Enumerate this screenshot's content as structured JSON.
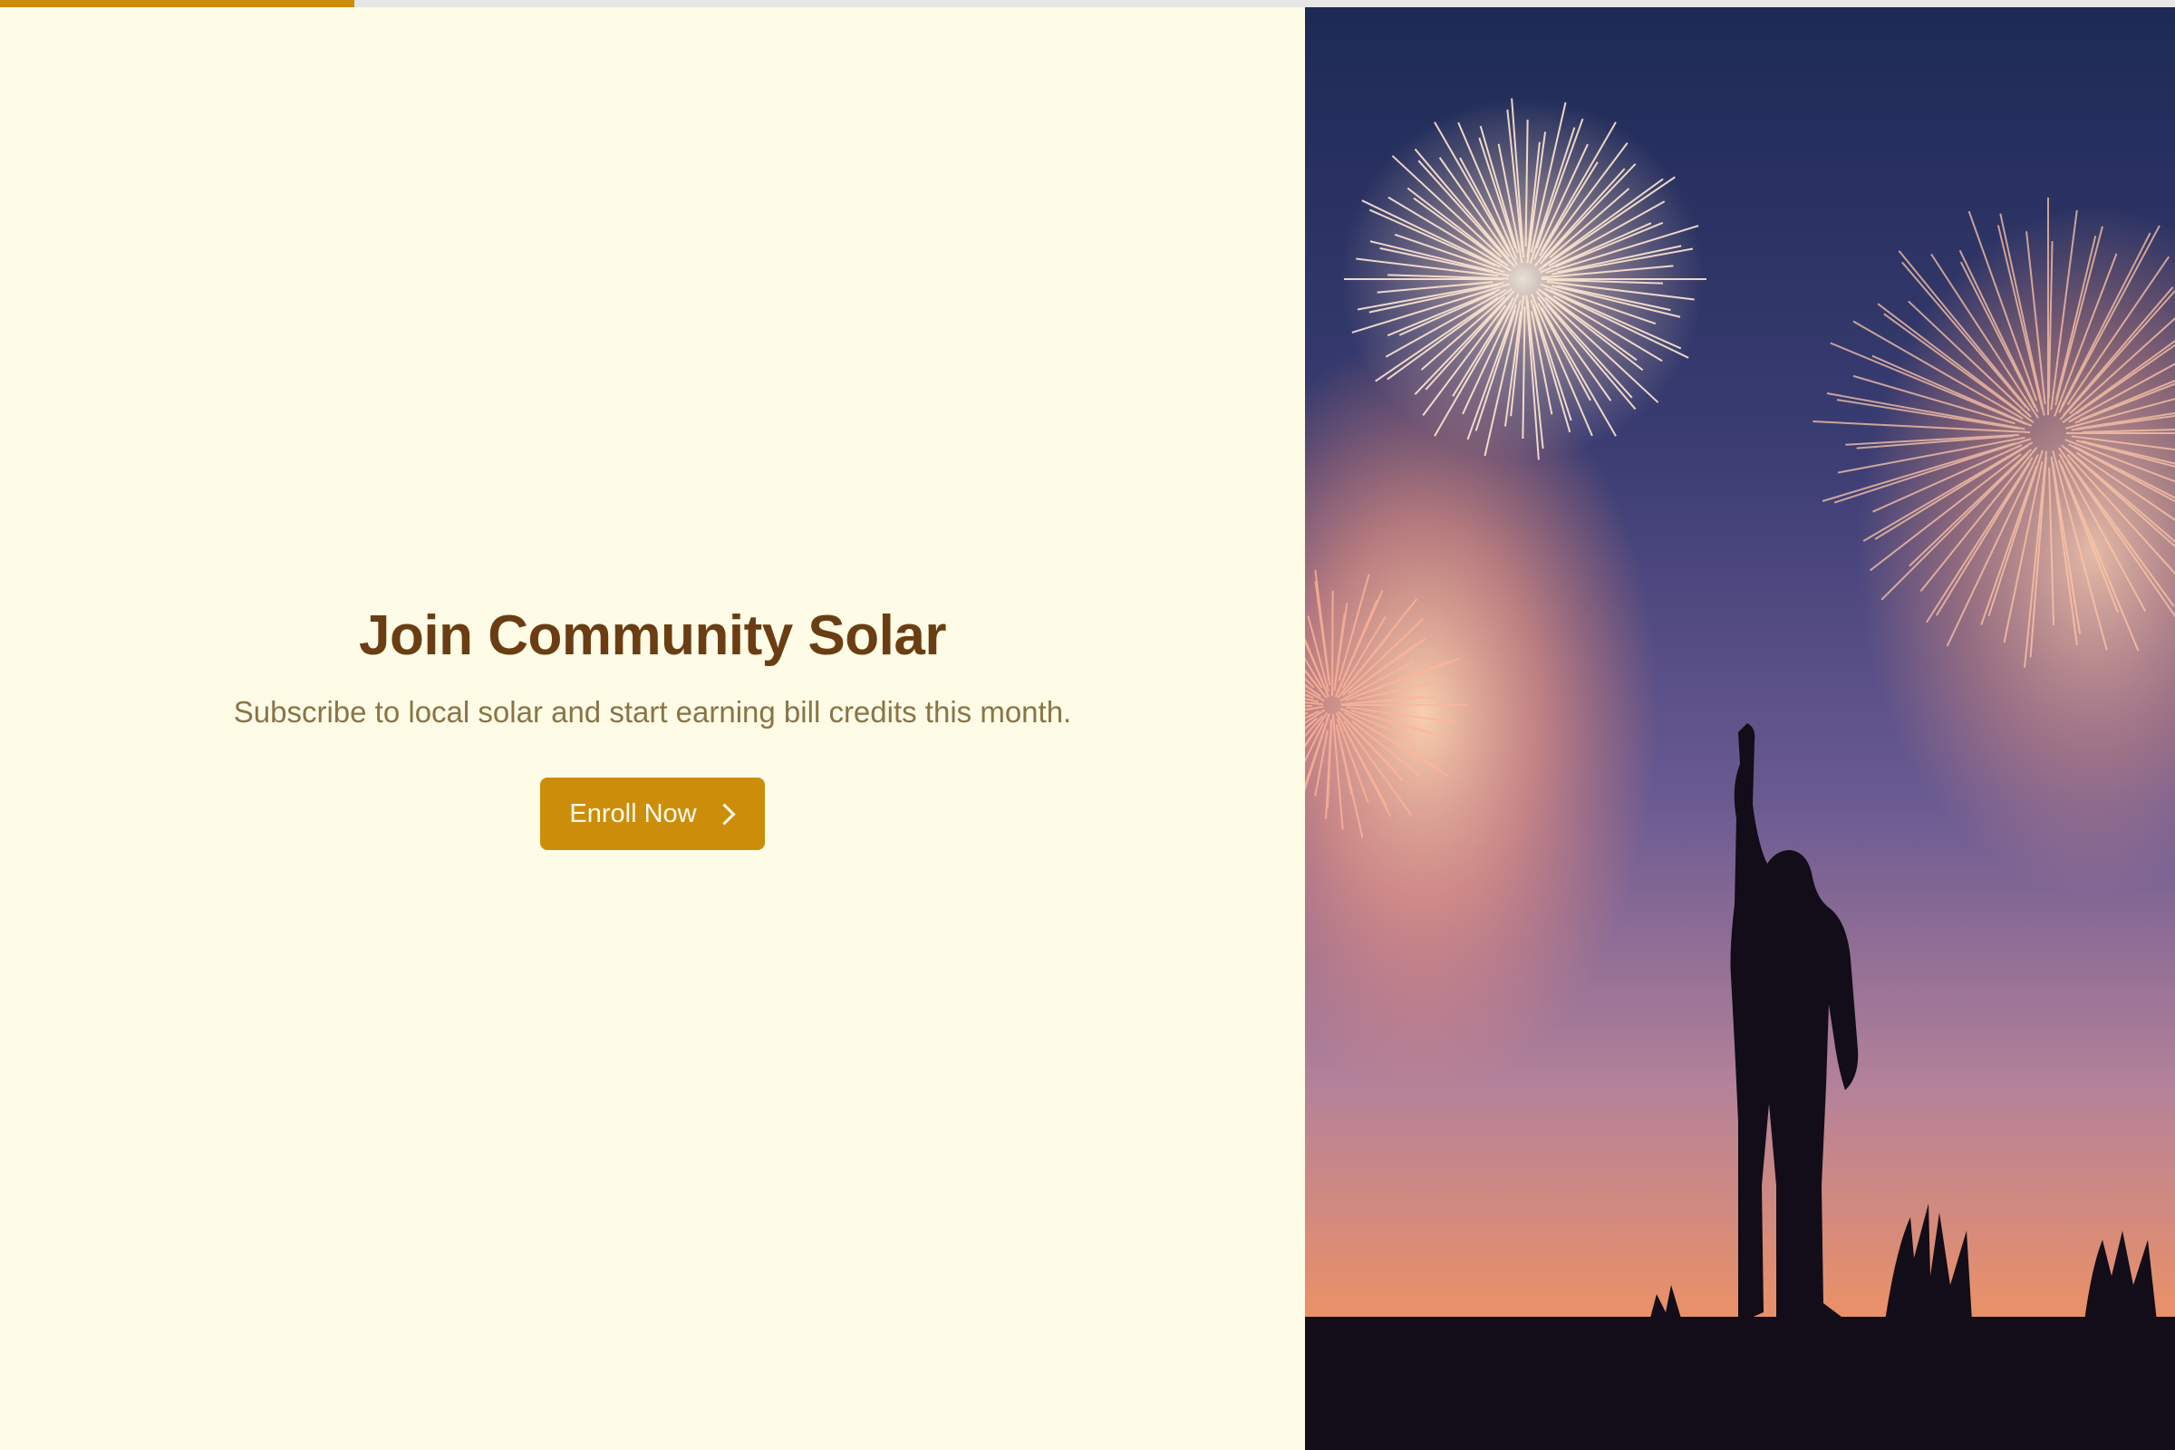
{
  "progress": {
    "value": 0.163,
    "color": "#cc8e0a"
  },
  "hero": {
    "title": "Join Community Solar",
    "subtitle": "Subscribe to local solar and start earning bill credits this month.",
    "cta_label": "Enroll Now",
    "cta_icon": "chevron-right-icon"
  },
  "photo": {
    "subject": "fireworks-silhouette"
  },
  "colors": {
    "background": "#fefbe6",
    "title": "#6b3d12",
    "subtitle": "#8a7446",
    "accent": "#cc8e0a"
  }
}
